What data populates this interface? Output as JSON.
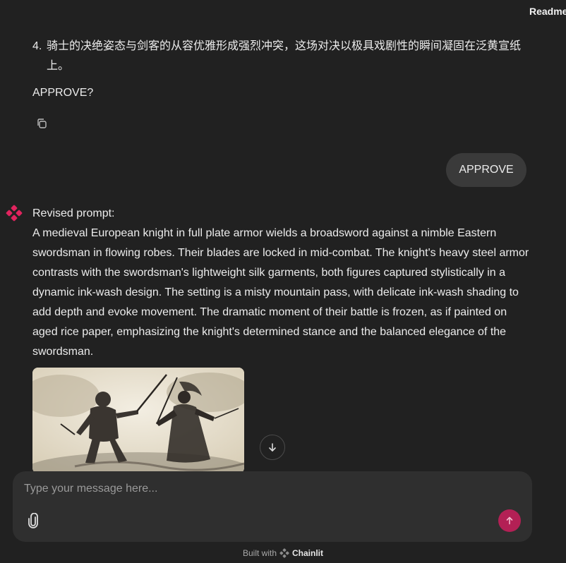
{
  "header": {
    "readme_label": "Readme"
  },
  "messages": {
    "previous_assistant": {
      "list_item_number": "4.",
      "list_item_text": "骑士的决绝姿态与剑客的从容优雅形成强烈冲突，这场对决以极具戏剧性的瞬间凝固在泛黄宣纸上。",
      "question": "APPROVE?",
      "copy_icon": "copy-icon"
    },
    "user": {
      "text": "APPROVE"
    },
    "assistant": {
      "avatar_icon": "chainlit-logo-icon",
      "heading": "Revised prompt:",
      "body": "A medieval European knight in full plate armor wields a broadsword against a nimble Eastern swordsman in flowing robes. Their blades are locked in mid-combat. The knight's heavy steel armor contrasts with the swordsman's lightweight silk garments, both figures captured stylistically in a dynamic ink-wash design. The setting is a misty mountain pass, with delicate ink-wash shading to add depth and evoke movement. The dramatic moment of their battle is frozen, as if painted on aged rice paper, emphasizing the knight's determined stance and the balanced elegance of the swordsman."
    }
  },
  "scroll_down_icon": "arrow-down-icon",
  "composer": {
    "placeholder": "Type your message here...",
    "attach_icon": "paperclip-icon",
    "send_icon": "arrow-up-icon"
  },
  "footer": {
    "built_with": "Built with",
    "brand": "Chainlit"
  },
  "colors": {
    "background": "#212121",
    "bubble": "#3a3a3a",
    "composer": "#2f2f2f",
    "accent": "#b32055",
    "avatar": "#e0245e"
  }
}
